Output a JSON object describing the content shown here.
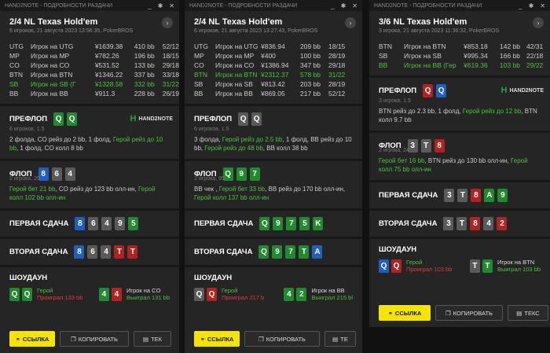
{
  "window_title": "HAND2NOTE - ПОДРОБНОСТИ РАЗДАЧИ",
  "titlebar_buttons": [
    "_",
    "✱",
    "✕"
  ],
  "labels": {
    "preflop": "ПРЕФЛОП",
    "flop": "ФЛОП",
    "turn": "ПЕРВАЯ СДАЧА",
    "river": "ВТОРАЯ СДАЧА",
    "showdown": "ШОУДАУН",
    "logo": "HAND2NOTE",
    "btn_link": "ССЫЛКА",
    "btn_copy": "КОПИРОВАТЬ",
    "btn_text_1": "ТЕК",
    "btn_text_2": "ТЕ",
    "btn_text_3": "ТЕКС"
  },
  "panels": [
    {
      "game": "2/4 NL Texas Hold'em",
      "info": "6 игроков, 21 августа 2023 13:56:35, PokerBROS",
      "players": [
        {
          "pos": "UTG",
          "name": "Игрок на UTG",
          "stack": "¥1639.38",
          "bb": "410 bb",
          "stat": "52/12"
        },
        {
          "pos": "MP",
          "name": "Игрок на MP",
          "stack": "¥782.26",
          "bb": "196 bb",
          "stat": "18/15"
        },
        {
          "pos": "CO",
          "name": "Игрок на CO",
          "stack": "¥531.52",
          "bb": "133 bb",
          "stat": "29/18"
        },
        {
          "pos": "BTN",
          "name": "Игрок на BTN",
          "stack": "¥1346.22",
          "bb": "337 bb",
          "stat": "33/18"
        },
        {
          "pos": "SB",
          "name": "Игрок на SB (Г",
          "stack": "¥1328.58",
          "bb": "332 bb",
          "stat": "31/22"
        },
        {
          "pos": "BB",
          "name": "Игрок на BB",
          "stack": "¥911.3",
          "bb": "228 bb",
          "stat": "26/19"
        }
      ],
      "preflop": {
        "sub": "6 игроков, 1.5",
        "cards": [
          "Q",
          "Q"
        ],
        "action_parts": [
          "2 фолда, CO рейз до 2 bb, 1 фолд, ",
          "Герой рейз до 10 bb",
          ", 1 фолд, CO колл 8 bb"
        ]
      },
      "flop": {
        "sub": "2 игрока, 20",
        "cards": [
          "8",
          "6",
          "4"
        ],
        "action_parts": [
          "Герой бет 21 bb",
          ", CO рейз до 123 bb олл-ин, ",
          "Герой колл 102 bb олл-ин",
          ""
        ]
      },
      "turn": {
        "cards": [
          "8",
          "6",
          "4",
          "9",
          "5"
        ]
      },
      "river": {
        "cards": [
          "8",
          "6",
          "4",
          "T",
          "T"
        ]
      },
      "showdown": {
        "left": {
          "cards": [
            "Q",
            "Q"
          ],
          "name": "Герой",
          "result": "Проиграл 133 bb"
        },
        "right": {
          "cards": [
            "4",
            "4"
          ],
          "name": "Игрок на CO",
          "result": "Выиграл 131 bb"
        }
      }
    },
    {
      "game": "2/4 NL Texas Hold'em",
      "info": "6 игроков, 21 августа 2023 13:27:43, PokerBROS",
      "players": [
        {
          "pos": "UTG",
          "name": "Игрок на UTG",
          "stack": "¥836.94",
          "bb": "209 bb",
          "stat": "18/15"
        },
        {
          "pos": "MP",
          "name": "Игрок на MP",
          "stack": "¥400",
          "bb": "100 bb",
          "stat": "28/19"
        },
        {
          "pos": "CO",
          "name": "Игрок на CO",
          "stack": "¥1386.94",
          "bb": "347 bb",
          "stat": "29/18"
        },
        {
          "pos": "BTN",
          "name": "Игрок на BTN",
          "stack": "¥2312.37",
          "bb": "578 bb",
          "stat": "31/22"
        },
        {
          "pos": "SB",
          "name": "Игрок на SB",
          "stack": "¥813.42",
          "bb": "203 bb",
          "stat": "28/19"
        },
        {
          "pos": "BB",
          "name": "Игрок на BB",
          "stack": "¥869.05",
          "bb": "217 bb",
          "stat": "52/12"
        }
      ],
      "preflop": {
        "sub": "6 игроков, 1.5",
        "cards": [
          "Q",
          "Q"
        ],
        "action_parts": [
          "3 фолда, ",
          "Герой рейз до 2.5 bb",
          ", 1 фолд, BB рейз до 10 bb, ",
          "Герой рейз до 48 bb",
          ", BB колл 38 bb"
        ]
      },
      "flop": {
        "sub": "2 игрока, 95",
        "cards": [
          "Q",
          "9",
          "7"
        ],
        "action_parts": [
          "BB чек , ",
          "Герой бет 33 bb",
          ", BB рейз до 170 bb олл-ин, ",
          "Герой колл 137 bb олл-ин",
          ""
        ]
      },
      "turn": {
        "cards": [
          "Q",
          "9",
          "7",
          "5",
          "K"
        ]
      },
      "river": {
        "cards": [
          "Q",
          "9",
          "7",
          "T",
          "A"
        ]
      },
      "showdown": {
        "left": {
          "cards": [
            "Q",
            "Q"
          ],
          "name": "Герой",
          "result": "Проиграл 217 b"
        },
        "right": {
          "cards": [
            "4",
            "2"
          ],
          "name": "Игрок на BB",
          "result": "Выиграл 215 bl"
        }
      }
    },
    {
      "game": "3/6 NL Texas Hold'em",
      "info": "3 игрока, 21 августа 2023 11:36:32, PokerBROS",
      "players": [
        {
          "pos": "BTN",
          "name": "Игрок на BTN",
          "stack": "¥853.18",
          "bb": "142 bb",
          "stat": "42/31"
        },
        {
          "pos": "SB",
          "name": "Игрок на SB",
          "stack": "¥995.34",
          "bb": "166 bb",
          "stat": "22/18"
        },
        {
          "pos": "BB",
          "name": "Игрок на BB (Гер",
          "stack": "¥619.36",
          "bb": "103 bb",
          "stat": "29/22"
        }
      ],
      "preflop": {
        "sub": "3 игрока, 1.5",
        "cards": [
          "Q",
          "Q"
        ],
        "action_parts": [
          "BTN рейз до 2.3 bb, 1 фолд, ",
          "Герой рейз до 12 bb",
          ", BTN колл 9.7 bb"
        ]
      },
      "flop": {
        "sub": "2 игрока, 24",
        "cards": [
          "3",
          "T",
          "8"
        ],
        "action_parts": [
          "Герой бет 16 bb",
          ", BTN рейз до 130 bb олл-ин, ",
          "Герой колл 75 bb олл-ин",
          ""
        ]
      },
      "turn": {
        "cards": [
          "3",
          "T",
          "8",
          "A",
          "9"
        ]
      },
      "river": {
        "cards": [
          "3",
          "T",
          "8",
          "4",
          "2"
        ]
      },
      "showdown": {
        "left": {
          "cards": [
            "Q",
            "Q"
          ],
          "name": "Герой",
          "result": "Проиграл 103 bb"
        },
        "right": {
          "cards": [
            "T",
            "T"
          ],
          "name": "Игрок на BTN",
          "result": "Выиграл 103 bb"
        }
      }
    }
  ]
}
